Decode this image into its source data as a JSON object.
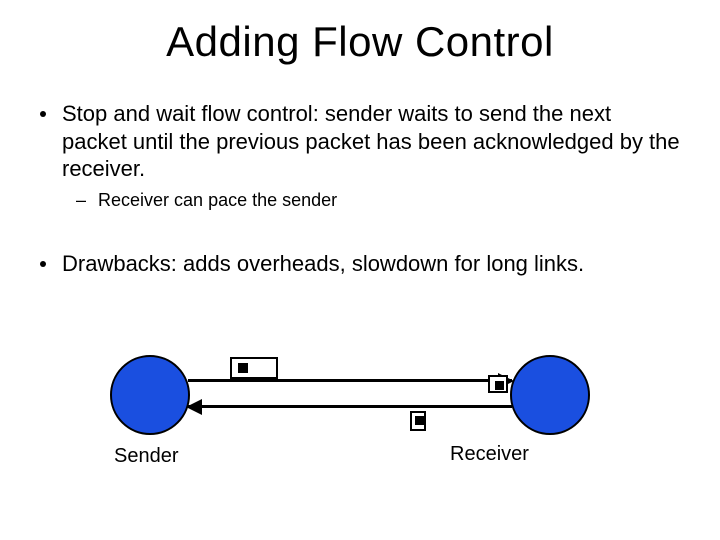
{
  "title": "Adding Flow Control",
  "bullets": {
    "b1": "Stop and wait flow control: sender waits to send the next packet until the previous packet has been acknowledged by the receiver.",
    "b1_sub": "Receiver can pace the sender",
    "b2": "Drawbacks: adds overheads, slowdown for long links."
  },
  "diagram": {
    "sender_label": "Sender",
    "receiver_label": "Receiver"
  }
}
